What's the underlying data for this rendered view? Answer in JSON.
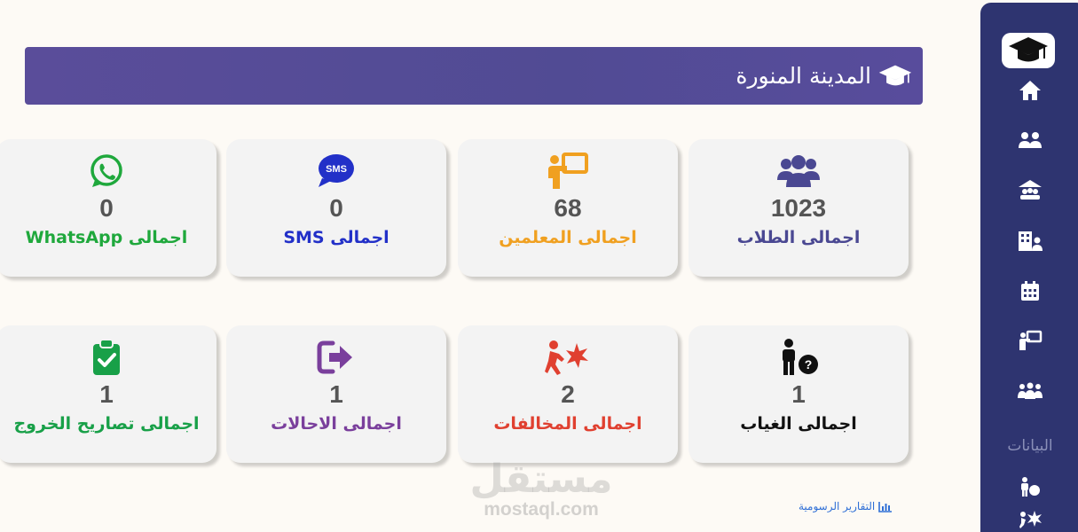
{
  "header": {
    "title": "المدينة المنورة",
    "icon": "graduation-cap-icon"
  },
  "sidebar": {
    "section_label": "البيانات",
    "icons": [
      "home-icon",
      "users-icon",
      "school-icon",
      "building-user-icon",
      "calendar-icon",
      "teacher-icon",
      "group-icon",
      "absence-icon",
      "violation-icon"
    ]
  },
  "cards": {
    "students": {
      "value": "1023",
      "label": "اجمالى الطلاب",
      "color": "#4a4892"
    },
    "teachers": {
      "value": "68",
      "label": "اجمالى المعلمين",
      "color": "#f0a020"
    },
    "sms": {
      "value": "0",
      "label": "اجمالى SMS",
      "color": "#2230c8"
    },
    "whatsapp": {
      "value": "0",
      "label": "اجمالى WhatsApp",
      "color": "#1fa83c"
    },
    "absence": {
      "value": "1",
      "label": "اجمالى الغياب",
      "color": "#111111"
    },
    "violations": {
      "value": "2",
      "label": "اجمالى المخالفات",
      "color": "#e04030"
    },
    "referrals": {
      "value": "1",
      "label": "اجمالى الاحالات",
      "color": "#7a3f9c"
    },
    "exit_permits": {
      "value": "1",
      "label": "اجمالى تصاريح الخروج",
      "color": "#18a048"
    }
  },
  "footer": {
    "reports_link": "التقارير الرسومية"
  },
  "watermark": {
    "arabic": "مستقل",
    "latin": "mostaql.com"
  }
}
